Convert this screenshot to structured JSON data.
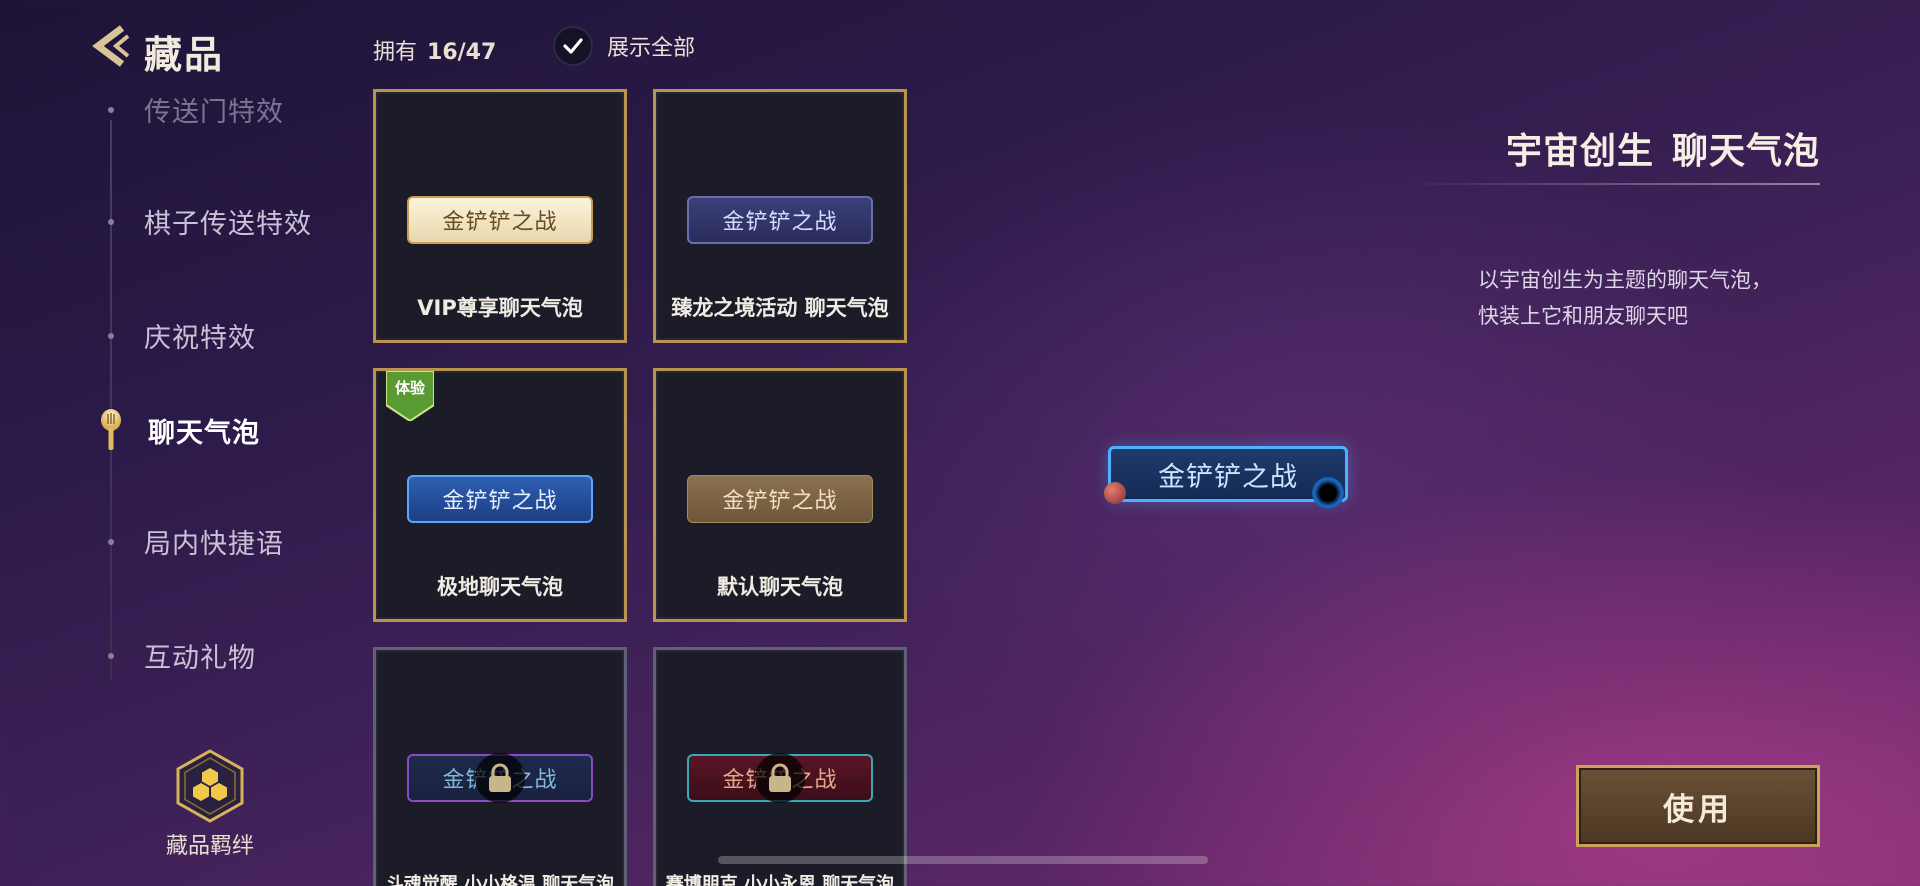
{
  "header": {
    "title": "藏品",
    "owned_label": "拥有",
    "owned_count": "16/47",
    "show_all_label": "展示全部",
    "show_all_checked": true
  },
  "sidebar": {
    "items": [
      {
        "label": "传送门特效",
        "state": "faded"
      },
      {
        "label": "棋子传送特效",
        "state": "normal"
      },
      {
        "label": "庆祝特效",
        "state": "normal"
      },
      {
        "label": "聊天气泡",
        "state": "active"
      },
      {
        "label": "局内快捷语",
        "state": "normal"
      },
      {
        "label": "互动礼物",
        "state": "normal"
      }
    ],
    "bond_label": "藏品羁绊"
  },
  "grid": {
    "items": [
      {
        "label": "VIP尊享聊天气泡",
        "bubble_text": "金铲铲之战",
        "locked": false
      },
      {
        "label": "臻龙之境活动 聊天气泡",
        "bubble_text": "金铲铲之战",
        "locked": false
      },
      {
        "label": "极地聊天气泡",
        "bubble_text": "金铲铲之战",
        "locked": false,
        "badge": "体验"
      },
      {
        "label": "默认聊天气泡",
        "bubble_text": "金铲铲之战",
        "locked": false
      },
      {
        "label": "斗魂觉醒 小小格温 聊天气泡",
        "bubble_text": "金铲铲之战",
        "locked": true
      },
      {
        "label": "赛博朋克 小小永恩 聊天气泡",
        "bubble_text": "金铲铲之战",
        "locked": true
      }
    ]
  },
  "preview": {
    "bubble_text": "金铲铲之战"
  },
  "detail": {
    "title_part1": "宇宙创生",
    "title_part2": "聊天气泡",
    "desc_line1": "以宇宙创生为主题的聊天气泡，",
    "desc_line2": "快装上它和朋友聊天吧",
    "use_label": "使用"
  },
  "colors": {
    "gold_border": "#b8954e",
    "locked_border": "#5f6276",
    "button_bg": "#5a432c"
  }
}
